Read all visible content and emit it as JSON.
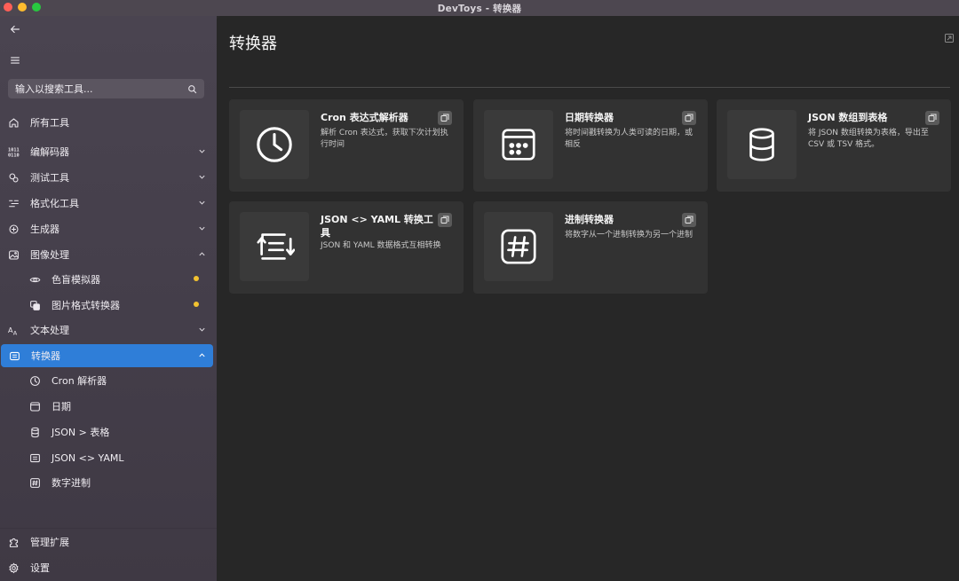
{
  "window": {
    "title": "DevToys - 转换器"
  },
  "sidebar": {
    "search": {
      "placeholder": "输入以搜索工具..."
    },
    "items": [
      {
        "label": "所有工具",
        "icon": "home-icon"
      },
      {
        "label": "编解码器",
        "icon": "binary-icon",
        "expanded": false
      },
      {
        "label": "测试工具",
        "icon": "test-icon",
        "expanded": false
      },
      {
        "label": "格式化工具",
        "icon": "format-icon",
        "expanded": false
      },
      {
        "label": "生成器",
        "icon": "generator-icon",
        "expanded": false
      },
      {
        "label": "图像处理",
        "icon": "image-icon",
        "expanded": true
      },
      {
        "label": "色盲模拟器",
        "icon": "eye-icon",
        "sub": true,
        "badge": true
      },
      {
        "label": "图片格式转换器",
        "icon": "image-convert-icon",
        "sub": true,
        "badge": true
      },
      {
        "label": "文本处理",
        "icon": "text-icon",
        "expanded": false
      },
      {
        "label": "转换器",
        "icon": "converter-icon",
        "expanded": true,
        "active": true
      },
      {
        "label": "Cron 解析器",
        "icon": "clock-icon",
        "sub": true
      },
      {
        "label": "日期",
        "icon": "calendar-icon",
        "sub": true
      },
      {
        "label": "JSON > 表格",
        "icon": "database-icon",
        "sub": true
      },
      {
        "label": "JSON <> YAML",
        "icon": "yaml-icon",
        "sub": true
      },
      {
        "label": "数字进制",
        "icon": "hash-icon",
        "sub": true
      }
    ],
    "footer": [
      {
        "label": "管理扩展",
        "icon": "extension-icon"
      },
      {
        "label": "设置",
        "icon": "settings-icon"
      }
    ]
  },
  "main": {
    "title": "转换器",
    "cards": [
      {
        "title": "Cron 表达式解析器",
        "desc": "解析 Cron 表达式，获取下次计划执行时间",
        "icon": "clock-icon"
      },
      {
        "title": "日期转换器",
        "desc": "将时间戳转换为人类可读的日期，或相反",
        "icon": "calendar-icon"
      },
      {
        "title": "JSON 数组到表格",
        "desc": "将 JSON 数组转换为表格，导出至 CSV 或 TSV 格式。",
        "icon": "database-icon"
      },
      {
        "title": "JSON <> YAML 转换工具",
        "desc": "JSON 和 YAML 数据格式互相转换",
        "icon": "yaml-icon"
      },
      {
        "title": "进制转换器",
        "desc": "将数字从一个进制转换为另一个进制",
        "icon": "hash-icon"
      }
    ]
  },
  "colors": {
    "accent": "#2f7ed8",
    "badge": "#f2c230",
    "sidebar_bg": "#463f4c",
    "main_bg": "#272727",
    "card_bg": "#323232"
  }
}
